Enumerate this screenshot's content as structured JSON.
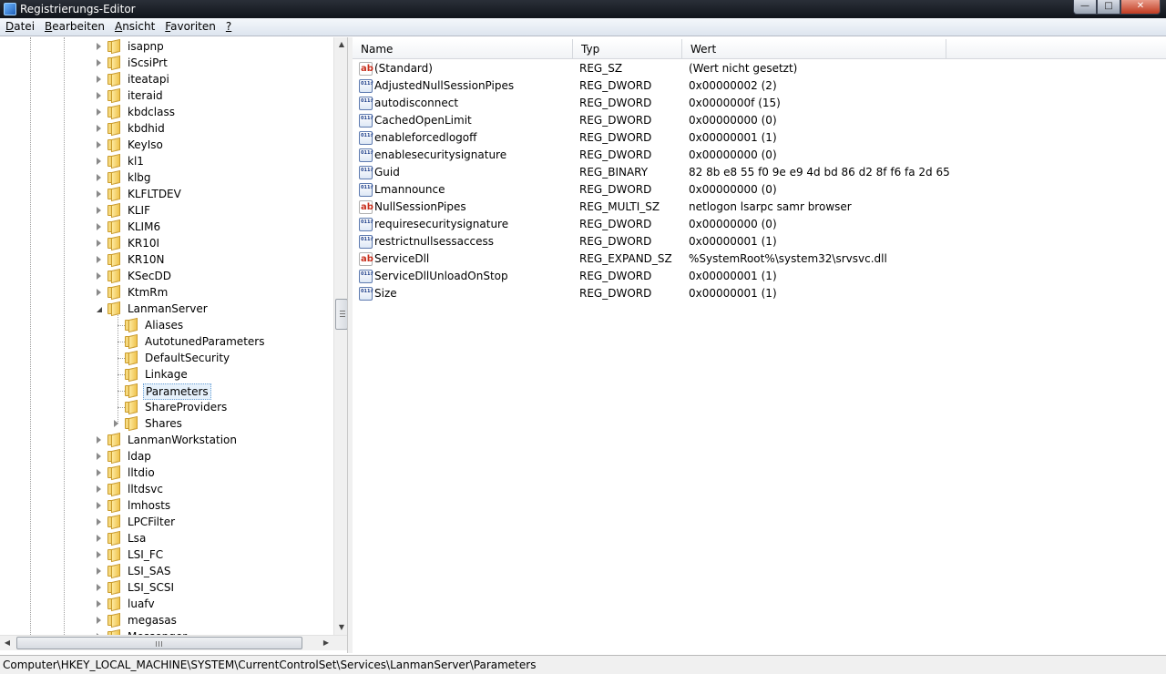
{
  "window": {
    "title": "Registrierungs-Editor",
    "buttons": {
      "minimize": "—",
      "maximize": "□",
      "close": "✕"
    }
  },
  "menu": [
    {
      "mnemonic": "D",
      "rest": "atei"
    },
    {
      "mnemonic": "B",
      "rest": "earbeiten"
    },
    {
      "mnemonic": "A",
      "rest": "nsicht"
    },
    {
      "mnemonic": "F",
      "rest": "avoriten"
    },
    {
      "mnemonic": "?",
      "rest": ""
    }
  ],
  "tree": {
    "items": [
      {
        "label": "isapnp",
        "level": 0,
        "state": "collapsed"
      },
      {
        "label": "iScsiPrt",
        "level": 0,
        "state": "collapsed"
      },
      {
        "label": "iteatapi",
        "level": 0,
        "state": "collapsed"
      },
      {
        "label": "iteraid",
        "level": 0,
        "state": "collapsed"
      },
      {
        "label": "kbdclass",
        "level": 0,
        "state": "collapsed"
      },
      {
        "label": "kbdhid",
        "level": 0,
        "state": "collapsed"
      },
      {
        "label": "KeyIso",
        "level": 0,
        "state": "collapsed"
      },
      {
        "label": "kl1",
        "level": 0,
        "state": "collapsed"
      },
      {
        "label": "klbg",
        "level": 0,
        "state": "collapsed"
      },
      {
        "label": "KLFLTDEV",
        "level": 0,
        "state": "collapsed"
      },
      {
        "label": "KLIF",
        "level": 0,
        "state": "collapsed"
      },
      {
        "label": "KLIM6",
        "level": 0,
        "state": "collapsed"
      },
      {
        "label": "KR10I",
        "level": 0,
        "state": "collapsed"
      },
      {
        "label": "KR10N",
        "level": 0,
        "state": "collapsed"
      },
      {
        "label": "KSecDD",
        "level": 0,
        "state": "collapsed"
      },
      {
        "label": "KtmRm",
        "level": 0,
        "state": "collapsed"
      },
      {
        "label": "LanmanServer",
        "level": 0,
        "state": "expanded"
      },
      {
        "label": "Aliases",
        "level": 1,
        "state": "leaf"
      },
      {
        "label": "AutotunedParameters",
        "level": 1,
        "state": "leaf"
      },
      {
        "label": "DefaultSecurity",
        "level": 1,
        "state": "leaf"
      },
      {
        "label": "Linkage",
        "level": 1,
        "state": "leaf"
      },
      {
        "label": "Parameters",
        "level": 1,
        "state": "leaf",
        "selected": true
      },
      {
        "label": "ShareProviders",
        "level": 1,
        "state": "leaf"
      },
      {
        "label": "Shares",
        "level": 1,
        "state": "collapsed"
      },
      {
        "label": "LanmanWorkstation",
        "level": 0,
        "state": "collapsed"
      },
      {
        "label": "ldap",
        "level": 0,
        "state": "collapsed"
      },
      {
        "label": "lltdio",
        "level": 0,
        "state": "collapsed"
      },
      {
        "label": "lltdsvc",
        "level": 0,
        "state": "collapsed"
      },
      {
        "label": "lmhosts",
        "level": 0,
        "state": "collapsed"
      },
      {
        "label": "LPCFilter",
        "level": 0,
        "state": "collapsed"
      },
      {
        "label": "Lsa",
        "level": 0,
        "state": "collapsed"
      },
      {
        "label": "LSI_FC",
        "level": 0,
        "state": "collapsed"
      },
      {
        "label": "LSI_SAS",
        "level": 0,
        "state": "collapsed"
      },
      {
        "label": "LSI_SCSI",
        "level": 0,
        "state": "collapsed"
      },
      {
        "label": "luafv",
        "level": 0,
        "state": "collapsed"
      },
      {
        "label": "megasas",
        "level": 0,
        "state": "collapsed"
      },
      {
        "label": "Messenger",
        "level": 0,
        "state": "collapsed"
      }
    ]
  },
  "list": {
    "columns": [
      {
        "label": "Name"
      },
      {
        "label": "Typ"
      },
      {
        "label": "Wert"
      }
    ],
    "rows": [
      {
        "icon": "string-value-icon",
        "name": "(Standard)",
        "type": "REG_SZ",
        "data": "(Wert nicht gesetzt)"
      },
      {
        "icon": "binary-value-icon",
        "name": "AdjustedNullSessionPipes",
        "type": "REG_DWORD",
        "data": "0x00000002 (2)"
      },
      {
        "icon": "binary-value-icon",
        "name": "autodisconnect",
        "type": "REG_DWORD",
        "data": "0x0000000f (15)"
      },
      {
        "icon": "binary-value-icon",
        "name": "CachedOpenLimit",
        "type": "REG_DWORD",
        "data": "0x00000000 (0)"
      },
      {
        "icon": "binary-value-icon",
        "name": "enableforcedlogoff",
        "type": "REG_DWORD",
        "data": "0x00000001 (1)"
      },
      {
        "icon": "binary-value-icon",
        "name": "enablesecuritysignature",
        "type": "REG_DWORD",
        "data": "0x00000000 (0)"
      },
      {
        "icon": "binary-value-icon",
        "name": "Guid",
        "type": "REG_BINARY",
        "data": "82 8b e8 55 f0 9e e9 4d bd 86 d2 8f f6 fa 2d 65"
      },
      {
        "icon": "binary-value-icon",
        "name": "Lmannounce",
        "type": "REG_DWORD",
        "data": "0x00000000 (0)"
      },
      {
        "icon": "string-value-icon",
        "name": "NullSessionPipes",
        "type": "REG_MULTI_SZ",
        "data": "netlogon lsarpc samr browser"
      },
      {
        "icon": "binary-value-icon",
        "name": "requiresecuritysignature",
        "type": "REG_DWORD",
        "data": "0x00000000 (0)"
      },
      {
        "icon": "binary-value-icon",
        "name": "restrictnullsessaccess",
        "type": "REG_DWORD",
        "data": "0x00000001 (1)"
      },
      {
        "icon": "string-value-icon",
        "name": "ServiceDll",
        "type": "REG_EXPAND_SZ",
        "data": "%SystemRoot%\\system32\\srvsvc.dll"
      },
      {
        "icon": "binary-value-icon",
        "name": "ServiceDllUnloadOnStop",
        "type": "REG_DWORD",
        "data": "0x00000001 (1)"
      },
      {
        "icon": "binary-value-icon",
        "name": "Size",
        "type": "REG_DWORD",
        "data": "0x00000001 (1)"
      }
    ]
  },
  "statusbar": {
    "path": "Computer\\HKEY_LOCAL_MACHINE\\SYSTEM\\CurrentControlSet\\Services\\LanmanServer\\Parameters"
  },
  "colors": {
    "titlebar": "#10141b",
    "selection": "#e6f1fb",
    "folder": "#efc34e"
  }
}
